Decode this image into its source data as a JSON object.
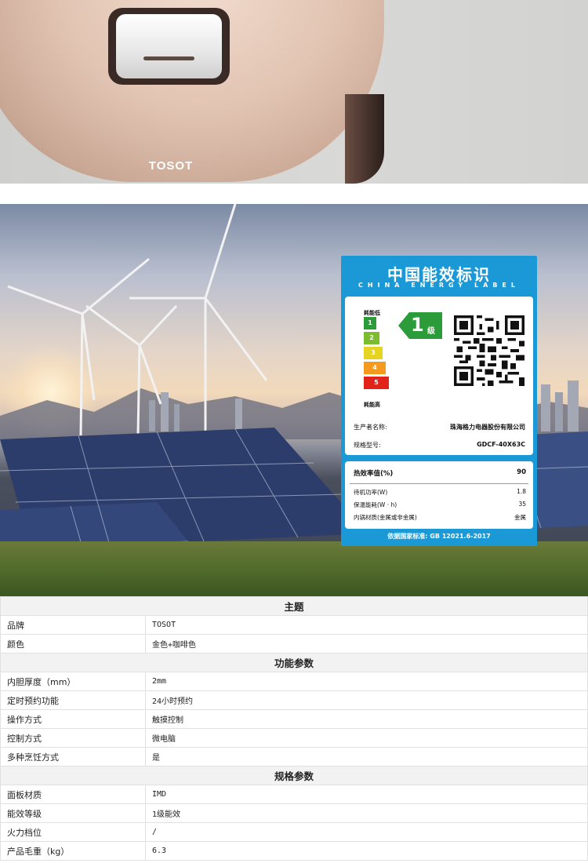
{
  "product": {
    "brand_logo": "TOSOT"
  },
  "energy_label": {
    "title": "中国能效标识",
    "subtitle": "CHINA ENERGY LABEL",
    "low_label": "耗能低",
    "high_label": "耗能高",
    "grades": [
      "1",
      "2",
      "3",
      "4",
      "5"
    ],
    "grade_colors": [
      "#2c9c3a",
      "#7bbd2e",
      "#e7d321",
      "#f39a1f",
      "#e2231a"
    ],
    "current_grade": "1",
    "grade_suffix": "级",
    "manufacturer_label": "生产者名称:",
    "manufacturer_value": "珠海格力电器股份有限公司",
    "model_label": "规格型号:",
    "model_value": "GDCF-40X63C",
    "thermal_efficiency_label": "热效率值(%)",
    "thermal_efficiency_value": "90",
    "standby_power_label": "待机功率(W)",
    "standby_power_value": "1.8",
    "keep_warm_label": "保温能耗(W · h)",
    "keep_warm_value": "35",
    "inner_pot_label": "内锅材质(金属或非金属)",
    "inner_pot_value": "金属",
    "standard": "依据国家标准: GB 12021.6-2017"
  },
  "spec_table": {
    "sections": [
      {
        "title": "主题",
        "rows": [
          {
            "k": "品牌",
            "v": "TOSOT"
          },
          {
            "k": "颜色",
            "v": "金色+咖啡色"
          }
        ]
      },
      {
        "title": "功能参数",
        "rows": [
          {
            "k": "内胆厚度（mm）",
            "v": "2mm"
          },
          {
            "k": "定时预约功能",
            "v": "24小时预约"
          },
          {
            "k": "操作方式",
            "v": "触摸控制"
          },
          {
            "k": "控制方式",
            "v": "微电脑"
          },
          {
            "k": "多种烹饪方式",
            "v": "是"
          }
        ]
      },
      {
        "title": "规格参数",
        "rows": [
          {
            "k": "面板材质",
            "v": "IMD"
          },
          {
            "k": "能效等级",
            "v": "1级能效"
          },
          {
            "k": "火力档位",
            "v": "/"
          },
          {
            "k": "产品毛重（kg）",
            "v": "6.3"
          }
        ]
      }
    ]
  }
}
